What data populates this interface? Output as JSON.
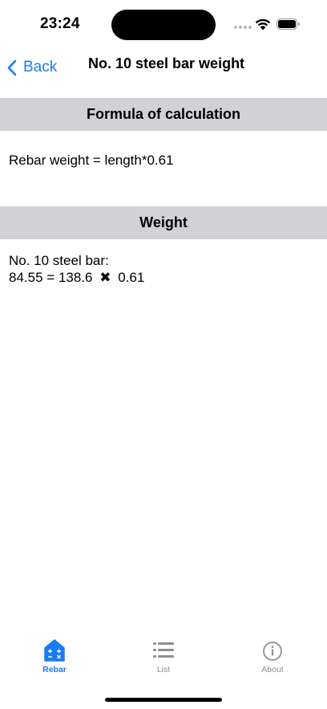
{
  "status_bar": {
    "time": "23:24"
  },
  "nav": {
    "back_label": "Back",
    "title": "No. 10 steel bar weight"
  },
  "sections": {
    "formula": {
      "header": "Formula of calculation",
      "text": "Rebar weight = length*0.61"
    },
    "weight": {
      "header": "Weight",
      "line1": "No. 10 steel bar:",
      "result": "84.55",
      "equals": "=",
      "length": "138.6",
      "times": "✖",
      "factor": "0.61"
    }
  },
  "tabs": [
    {
      "label": "Rebar",
      "icon": "calculator-house-icon",
      "active": true
    },
    {
      "label": "List",
      "icon": "list-icon",
      "active": false
    },
    {
      "label": "About",
      "icon": "info-icon",
      "active": false
    }
  ],
  "colors": {
    "accent": "#1a7cf5",
    "section_bg": "#d1d1d6",
    "inactive": "#8e8e93"
  }
}
